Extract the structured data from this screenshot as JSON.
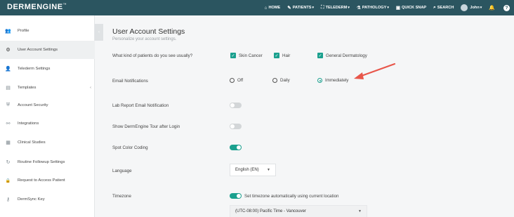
{
  "brand": {
    "name": "DERMENGINE",
    "mark": "™"
  },
  "nav": {
    "items": [
      {
        "icon": "home-icon",
        "glyph": "⌂",
        "label": "HOME",
        "caret": false
      },
      {
        "icon": "patients-icon",
        "glyph": "✎",
        "label": "PATIENTS",
        "caret": true
      },
      {
        "icon": "telederm-icon",
        "glyph": "⛶",
        "label": "TELEDERM",
        "caret": true
      },
      {
        "icon": "pathology-icon",
        "glyph": "⚗",
        "label": "PATHOLOGY",
        "caret": true
      },
      {
        "icon": "quick-snap-icon",
        "glyph": "▣",
        "label": "QUICK SNAP",
        "caret": false
      },
      {
        "icon": "search-icon",
        "glyph": "⌕",
        "label": "SEARCH",
        "caret": false
      }
    ],
    "user": {
      "label": "John",
      "caret": true
    },
    "bell_glyph": "🔔",
    "help_glyph": "?"
  },
  "sidebar": {
    "items": [
      {
        "icon": "profile-icon",
        "glyph": "👥",
        "label": "Profile",
        "active": false
      },
      {
        "icon": "gear-icon",
        "glyph": "⚙",
        "label": "User Account Settings",
        "active": true
      },
      {
        "icon": "telederm-settings-icon",
        "glyph": "👤",
        "label": "Telederm Settings",
        "active": false
      },
      {
        "icon": "document-icon",
        "glyph": "▤",
        "label": "Templates",
        "active": false,
        "chevron": "‹"
      },
      {
        "icon": "shield-icon",
        "glyph": "⛨",
        "label": "Account Security",
        "active": false
      },
      {
        "icon": "integrations-icon",
        "glyph": "⚯",
        "label": "Integrations",
        "active": false
      },
      {
        "icon": "clinical-studies-icon",
        "glyph": "▦",
        "label": "Clinical Studies",
        "active": false
      },
      {
        "icon": "routine-followup-icon",
        "glyph": "↻",
        "label": "Routine Followup Settings",
        "active": false
      },
      {
        "icon": "lock-icon",
        "glyph": "🔒",
        "label": "Request to Access Patient",
        "active": false
      },
      {
        "icon": "key-icon",
        "glyph": "⚷",
        "label": "DermSync Key",
        "active": false
      }
    ],
    "collapse_glyph": "‹"
  },
  "main": {
    "title": "User Account Settings",
    "subtitle": "Personalize your account settings.",
    "patients_question": "What kind of patients do you see usually?",
    "patient_types": [
      {
        "label": "Skin Cancer",
        "checked": true
      },
      {
        "label": "Hair",
        "checked": true
      },
      {
        "label": "General Dermatology",
        "checked": true
      }
    ],
    "email_notifications_label": "Email Notifications",
    "email_options": [
      {
        "label": "Off",
        "selected": false
      },
      {
        "label": "Daily",
        "selected": false
      },
      {
        "label": "Immediately",
        "selected": true
      }
    ],
    "lab_report_label": "Lab Report Email Notification",
    "lab_report_on": false,
    "tour_label": "Show DermEngine Tour after Login",
    "tour_on": false,
    "spot_color_label": "Spot Color Coding",
    "spot_color_on": true,
    "language_label": "Language",
    "language_value": "English (EN)",
    "timezone_label": "Timezone",
    "timezone_auto_label": "Set timezone automatically using current location",
    "timezone_auto_on": true,
    "timezone_value": "(UTC-08:00)   Pacific Time - Vancouver"
  },
  "colors": {
    "topbar": "#2b5560",
    "accent": "#1aa08e",
    "arrow": "#e8564a"
  }
}
